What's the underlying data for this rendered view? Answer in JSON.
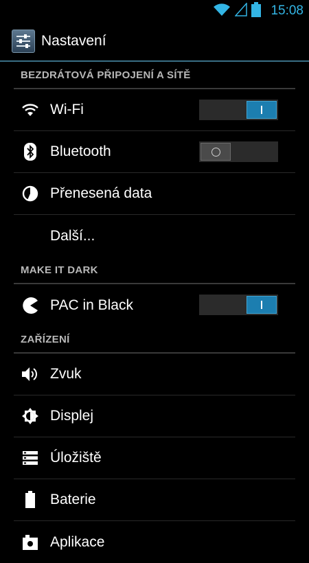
{
  "status_bar": {
    "time": "15:08",
    "accent": "#33b5e5"
  },
  "action_bar": {
    "title": "Nastavení",
    "icon": "settings-sliders-icon"
  },
  "sections": [
    {
      "label": "BEZDRÁTOVÁ PŘIPOJENÍ A SÍTĚ",
      "items": [
        {
          "label": "Wi-Fi",
          "icon": "wifi-icon",
          "toggle": "on"
        },
        {
          "label": "Bluetooth",
          "icon": "bluetooth-icon",
          "toggle": "off"
        },
        {
          "label": "Přenesená data",
          "icon": "data-usage-icon"
        },
        {
          "label": "Další...",
          "icon": ""
        }
      ]
    },
    {
      "label": "MAKE IT DARK",
      "items": [
        {
          "label": "PAC in Black",
          "icon": "pacman-icon",
          "toggle": "on"
        }
      ]
    },
    {
      "label": "ZAŘÍZENÍ",
      "items": [
        {
          "label": "Zvuk",
          "icon": "sound-icon"
        },
        {
          "label": "Displej",
          "icon": "brightness-icon"
        },
        {
          "label": "Úložiště",
          "icon": "storage-icon"
        },
        {
          "label": "Baterie",
          "icon": "battery-icon"
        },
        {
          "label": "Aplikace",
          "icon": "apps-icon"
        }
      ]
    }
  ]
}
